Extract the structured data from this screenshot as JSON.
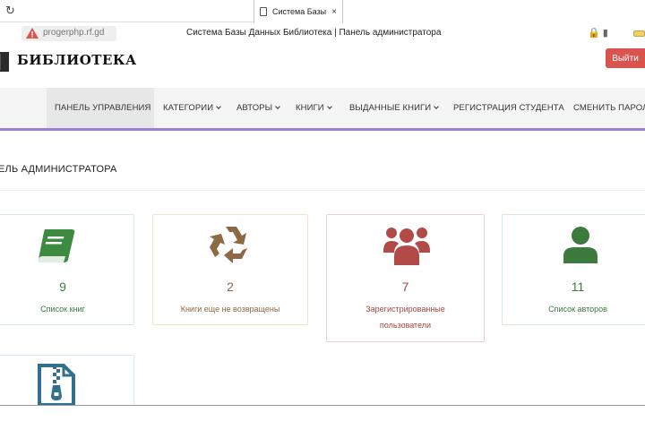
{
  "browser": {
    "tab_title": "Система Базы",
    "tab_close": "×",
    "url": "progerphp.rf.gd",
    "window_title": "Система Базы Данных Библиотека | Панель администратора",
    "icons": [
      "doc-icon",
      "reload-icon",
      "warning-icon",
      "lock-icon",
      "bookmark-icon",
      "battery-icon"
    ]
  },
  "site": {
    "logo_text": "БИБЛИОТЕКА",
    "logout_label": "Выйти"
  },
  "nav": {
    "items": [
      {
        "label": "ПАНЕЛЬ УПРАВЛЕНИЯ",
        "active": true
      },
      {
        "label": "КАТЕГОРИИ",
        "dropdown": true
      },
      {
        "label": "АВТОРЫ",
        "dropdown": true
      },
      {
        "label": "КНИГИ",
        "dropdown": true
      },
      {
        "label": "ВЫДАННЫЕ КНИГИ",
        "dropdown": true
      },
      {
        "label": "РЕГИСТРАЦИЯ СТУДЕНТА"
      },
      {
        "label": "СМЕНИТЬ ПАРОЛ"
      }
    ],
    "active_border_color": "#9b7fd4"
  },
  "page": {
    "heading": "ЕЛЬ АДМИНИСТРАТОРА"
  },
  "cards": [
    {
      "icon": "book-icon",
      "count": "9",
      "label": "Список книг",
      "color": "#3d7a3d"
    },
    {
      "icon": "recycle-icon",
      "count": "2",
      "label": "Книги еще не возвращены",
      "color": "#8c6a43"
    },
    {
      "icon": "users-group-icon",
      "count": "7",
      "label_line1": "Зарегистрированные",
      "label_line2": "пользователи",
      "color": "#a94442"
    },
    {
      "icon": "user-icon",
      "count": "11",
      "label": "Список авторов",
      "color": "#3d7a3d"
    },
    {
      "icon": "zip-file-icon",
      "color": "#31708f"
    }
  ]
}
